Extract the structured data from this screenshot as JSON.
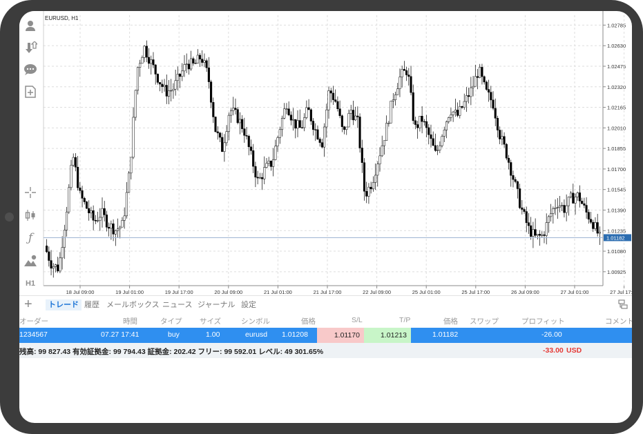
{
  "chart": {
    "title": "EURUSD, H1",
    "price_labels": [
      "1.02785",
      "1.02630",
      "1.02475",
      "1.02320",
      "1.02165",
      "1.02010",
      "1.01855",
      "1.01700",
      "1.01545",
      "1.01390",
      "1.01235",
      "1.01080",
      "1.00925"
    ],
    "current_price": "1.01182",
    "time_labels": [
      "18 Jul 09:00",
      "19 Jul 01:00",
      "19 Jul 17:00",
      "20 Jul 09:00",
      "21 Jul 01:00",
      "21 Jul 17:00",
      "22 Jul 09:00",
      "25 Jul 01:00",
      "25 Jul 17:00",
      "26 Jul 09:00",
      "27 Jul 01:00",
      "27 Jul 17:00"
    ],
    "bull_color": "#ffffff",
    "bear_color": "#000000",
    "current_line_color": "#9fb4d2",
    "current_label_color": "#2b6cb0"
  },
  "chart_data": {
    "type": "candlestick",
    "symbol": "EURUSD",
    "timeframe": "H1",
    "ylim": [
      1.0082,
      1.0286
    ],
    "current": 1.01182,
    "x": [
      "18 Jul 09:00",
      "19 Jul 01:00",
      "19 Jul 17:00",
      "20 Jul 09:00",
      "21 Jul 01:00",
      "21 Jul 17:00",
      "22 Jul 09:00",
      "25 Jul 01:00",
      "25 Jul 17:00",
      "26 Jul 09:00",
      "27 Jul 01:00",
      "27 Jul 17:00"
    ],
    "close_path": [
      1.0112,
      1.0098,
      1.0095,
      1.0135,
      1.018,
      1.015,
      1.014,
      1.013,
      1.0137,
      1.0128,
      1.0124,
      1.0128,
      1.017,
      1.0245,
      1.0262,
      1.025,
      1.0238,
      1.0228,
      1.023,
      1.024,
      1.025,
      1.0248,
      1.0255,
      1.024,
      1.02,
      1.0185,
      1.0215,
      1.021,
      1.02,
      1.018,
      1.016,
      1.017,
      1.0175,
      1.02,
      1.022,
      1.0205,
      1.02,
      1.0215,
      1.02,
      1.019,
      1.023,
      1.022,
      1.0195,
      1.0215,
      1.0205,
      1.015,
      1.016,
      1.018,
      1.02,
      1.0225,
      1.024,
      1.0245,
      1.02,
      1.0208,
      1.0195,
      1.018,
      1.02,
      1.0215,
      1.021,
      1.022,
      1.023,
      1.0245,
      1.0228,
      1.022,
      1.0195,
      1.018,
      1.016,
      1.014,
      1.0125,
      1.0118,
      1.012,
      1.0135,
      1.0145,
      1.014,
      1.0148,
      1.015,
      1.0138,
      1.013,
      1.0118
    ]
  },
  "sidebar": {
    "items": [
      "account-icon",
      "trade-transfer-icon",
      "chat-icon",
      "new-order-icon",
      "crosshair-icon",
      "candles-icon",
      "indicator-icon",
      "objects-icon",
      "timeframe-label"
    ],
    "timeframe": "H1"
  },
  "tabs": [
    "トレード",
    "履歴",
    "メールボックス",
    "ニュース",
    "ジャーナル",
    "設定"
  ],
  "table": {
    "headers": [
      "オーダー",
      "時間",
      "タイプ",
      "サイズ",
      "シンボル",
      "価格",
      "S/L",
      "T/P",
      "価格",
      "スワップ",
      "プロフィット",
      "コメント"
    ],
    "row": {
      "order": "1234567",
      "time": "07.27 17:41",
      "type": "buy",
      "size": "1.00",
      "symbol": "eurusd",
      "open_price": "1.01208",
      "sl": "1.01170",
      "tp": "1.01213",
      "price": "1.01182",
      "swap": "",
      "profit": "-26.00",
      "comment": ""
    },
    "row_color": "#2f8ff0",
    "sl_color": "#f8c9c9",
    "tp_color": "#c8f5c8"
  },
  "summary": {
    "text": "残高: 99 827.43 有効証拠金: 99 794.43 証拠金: 202.42 フリー: 99 592.01 レベル: 49 301.65%",
    "total": "-33.00",
    "currency": "USD"
  }
}
